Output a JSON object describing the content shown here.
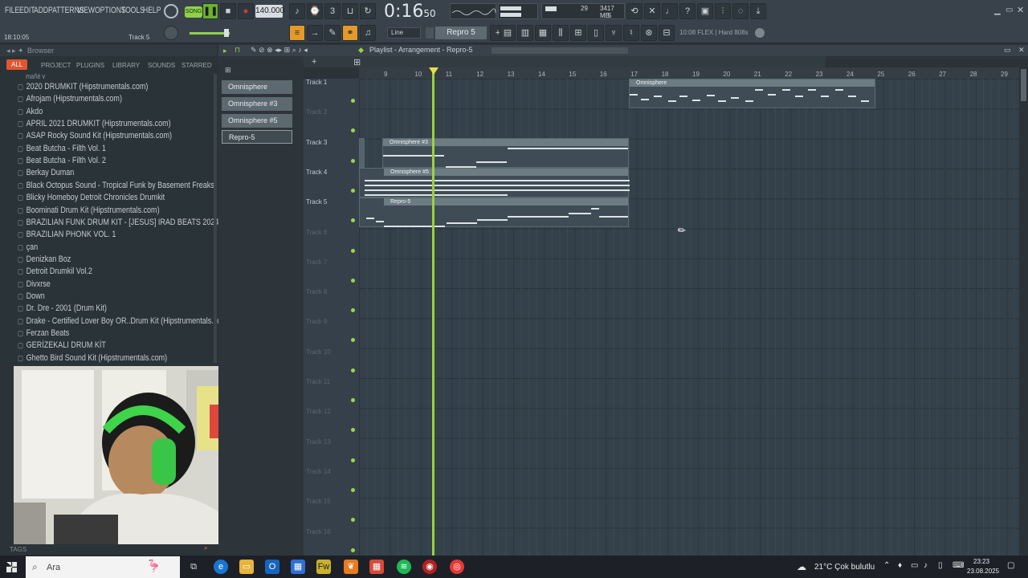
{
  "menu": [
    "FILE",
    "EDIT",
    "ADD",
    "PATTERNS",
    "VIEW",
    "OPTIONS",
    "TOOLS",
    "HELP"
  ],
  "transport": {
    "mode": "SONG",
    "tempo": "140.000",
    "time_main": "0:16",
    "time_sub": "50",
    "cpu": "29",
    "memory": "3417 MB",
    "voices": "5"
  },
  "hint_bar": {
    "left_time": "18:10:05",
    "track_hint": "Track 5",
    "snap_label": "Line",
    "pattern_name": "Repro 5",
    "news": "10:08  FLEX | Hard 808s"
  },
  "browser": {
    "title": "Browser",
    "tabs": [
      "ALL",
      "PROJECT",
      "PLUGINS",
      "LIBRARY",
      "SOUNDS",
      "STARRED"
    ],
    "partial_item": "mañé y",
    "folders": [
      "2020 DRUMKIT (Hipstrumentals.com)",
      "Afrojam (Hipstrumentals.com)",
      "Akdo",
      "APRIL 2021 DRUMKIT (Hipstrumentals.com)",
      "ASAP Rocky Sound Kit (Hipstrumentals.com)",
      "Beat Butcha - Filth Vol. 1",
      "Beat Butcha - Filth Vol. 2",
      "Berkay Duman",
      "Black Octopus Sound - Tropical Funk by Basement Freaks",
      "Blicky Homeboy Detroit Chronicles Drumkit",
      "Boominati Drum Kit (Hipstrumentals.com)",
      "BRAZILIAN FUNK DRUM KIT - [JESUS] IRAD BEATS 2024",
      "BRAZILIAN PHONK VOL. 1",
      "çan",
      "Denizkan Boz",
      "Detroit Drumkil Vol.2",
      "Divxrse",
      "Down",
      "Dr. Dre - 2001 (Drum Kit)",
      "Drake - Certified Lover Boy OR..Drum Kit (Hipstrumentals.com)",
      "Ferzan Beats",
      "GERİZEKALI DRUM KİT",
      "Ghetto Bird Sound Kit (Hipstrumentals.com)"
    ],
    "tags_label": "TAGS"
  },
  "picker": [
    "Omnisphere",
    "Omnisphere #3",
    "Omnisphere #5",
    "Repro-5"
  ],
  "playlist": {
    "title": "Playlist - Arrangement - Repro-5",
    "ruler": [
      "9",
      "10",
      "11",
      "12",
      "13",
      "14",
      "15",
      "16",
      "17",
      "18",
      "19",
      "20",
      "21",
      "22",
      "23",
      "24",
      "25",
      "26",
      "27",
      "28",
      "29"
    ],
    "tracks": [
      "Track 1",
      "Track 2",
      "Track 3",
      "Track 4",
      "Track 5",
      "Track 6",
      "Track 7",
      "Track 8",
      "Track 9",
      "Track 10",
      "Track 11",
      "Track 12",
      "Track 13",
      "Track 14",
      "Track 15",
      "Track 16"
    ],
    "clips": [
      {
        "name": "Omnisphere"
      },
      {
        "name": "Omnisphere #3"
      },
      {
        "name": "Omnisphere #5"
      },
      {
        "name": "Repro-5"
      }
    ]
  },
  "taskbar": {
    "search_placeholder": "Ara",
    "weather": "21°C  Çok bulutlu",
    "time": "23:23",
    "date": "23.08.2025"
  },
  "colors": {
    "accent_orange": "#e49a2a",
    "playhead": "#9bd33f",
    "record_red": "#d23a3a",
    "tab_active": "#e0562f"
  }
}
